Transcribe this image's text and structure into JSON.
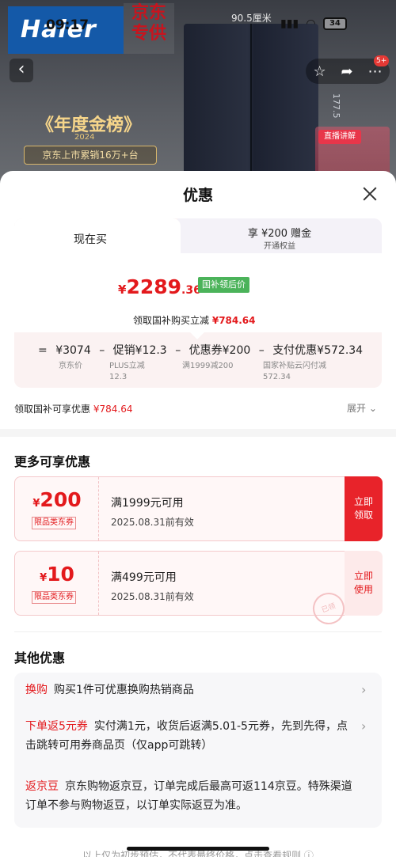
{
  "status_bar": {
    "time": "09:17",
    "signal": "::::",
    "wifi": "wifi",
    "battery": "34"
  },
  "banner": {
    "brand": "Haier",
    "jd_tag": "京东专供",
    "size_label": "90.5厘米",
    "size_vertical": "177.5",
    "award_title": "《年度金榜》",
    "award_year": "2024",
    "sales_text": "京东上市累销16万+台",
    "live_text": "直播讲解",
    "message_badge": "5+"
  },
  "sheet": {
    "title": "优惠",
    "tabs": {
      "now": "现在买",
      "plus_line1": "享 ¥200 赠金",
      "plus_line2": "开通权益"
    },
    "price": {
      "yen": "¥",
      "integer": "2289",
      "decimal": ".36",
      "tag": "国补领后价",
      "gov_discount_label": "领取国补购买立减",
      "gov_discount_value": "¥784.64"
    },
    "breakdown": {
      "formula": [
        "=",
        "¥3074",
        "–",
        "促销¥12.3",
        "–",
        "优惠券¥200",
        "–",
        "支付优惠¥572.34"
      ],
      "subs": [
        "京东价",
        "PLUS立减\n12.3",
        "满1999减200",
        "国家补贴云闪付减\n572.34"
      ]
    },
    "gov_row": {
      "label": "领取国补可享优惠",
      "value": "¥784.64",
      "expand": "展开"
    },
    "more_title": "更多可享优惠",
    "coupons": [
      {
        "yen": "¥",
        "amount": "200",
        "category": "限品类东券",
        "condition": "满1999元可用",
        "expiry": "2025.08.31前有效",
        "action": "立即\n领取"
      },
      {
        "yen": "¥",
        "amount": "10",
        "category": "限品类东券",
        "condition": "满499元可用",
        "expiry": "2025.08.31前有效",
        "action": "立即\n使用",
        "stamp": "已领"
      }
    ],
    "others_title": "其他优惠",
    "others": [
      {
        "tag": "换购",
        "text": "购买1件可优惠换购热销商品"
      },
      {
        "tag": "下单返5元券",
        "text": "实付满1元，收货后返满5.01-5元券，先到先得，点击跳转可用券商品页（仅app可跳转）"
      },
      {
        "tag": "返京豆",
        "text": "京东购物返京豆，订单完成后最高可返114京豆。特殊渠道订单不参与购物返豆，以订单实际返豆为准。"
      }
    ],
    "bottom_note": "以上仅为初步预估，不代表最终价格，点击查看规则 ⓘ"
  }
}
